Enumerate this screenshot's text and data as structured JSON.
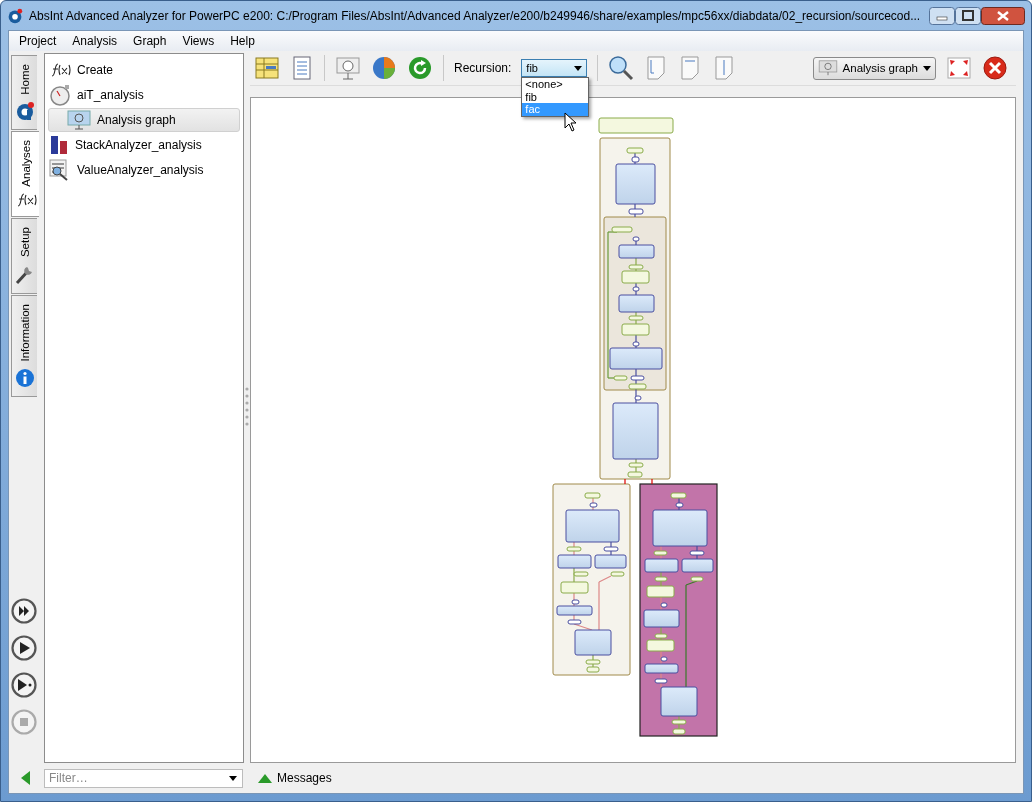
{
  "window": {
    "title": "AbsInt Advanced Analyzer for PowerPC e200: C:/Program Files/AbsInt/Advanced Analyzer/e200/b249946/share/examples/mpc56xx/diabdata/02_recursion/sourcecod..."
  },
  "menu": [
    "Project",
    "Analysis",
    "Graph",
    "Views",
    "Help"
  ],
  "side_tabs": [
    {
      "label": "Home",
      "kind": "home",
      "selected": false
    },
    {
      "label": "Analyses",
      "kind": "fx",
      "selected": true
    },
    {
      "label": "Setup",
      "kind": "wrench",
      "selected": false
    },
    {
      "label": "Information",
      "kind": "info",
      "selected": false
    }
  ],
  "tree": [
    {
      "label": "Create",
      "kind": "fx",
      "selected": false
    },
    {
      "label": "aiT_analysis",
      "kind": "clock",
      "selected": false,
      "children": [
        {
          "label": "Analysis graph",
          "kind": "graph",
          "selected": true
        }
      ]
    },
    {
      "label": "StackAnalyzer_analysis",
      "kind": "bars",
      "selected": false
    },
    {
      "label": "ValueAnalyzer_analysis",
      "kind": "binary",
      "selected": false
    }
  ],
  "recursion": {
    "label": "Recursion:",
    "value": "fib",
    "options": [
      {
        "label": "<none>",
        "highlighted": false
      },
      {
        "label": "fib",
        "highlighted": false
      },
      {
        "label": "fac",
        "highlighted": true
      }
    ]
  },
  "view_button": "Analysis graph",
  "filter": {
    "placeholder": "Filter…"
  },
  "messages": "Messages"
}
